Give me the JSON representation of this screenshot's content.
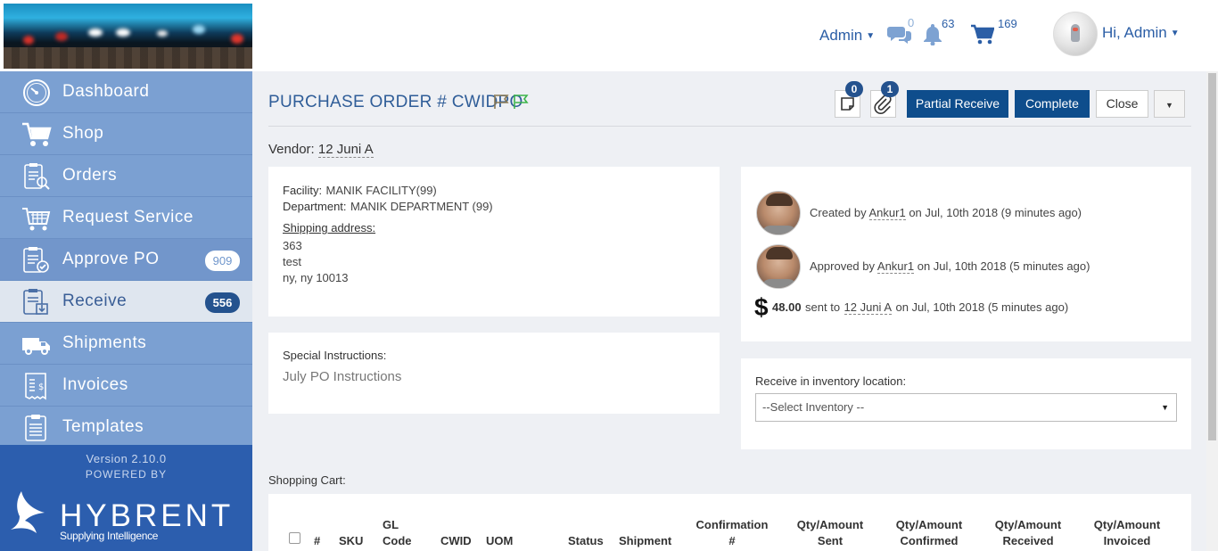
{
  "header": {
    "admin_label": "Admin",
    "messages_count": "0",
    "notifications_count": "63",
    "cart_count": "169",
    "greeting": "Hi, Admin"
  },
  "sidebar": {
    "items": [
      {
        "label": "Dashboard",
        "icon": "dashboard-icon"
      },
      {
        "label": "Shop",
        "icon": "cart-icon"
      },
      {
        "label": "Orders",
        "icon": "orders-icon"
      },
      {
        "label": "Request Service",
        "icon": "request-service-icon"
      },
      {
        "label": "Approve PO",
        "icon": "approve-icon",
        "badge": "909"
      },
      {
        "label": "Receive",
        "icon": "receive-icon",
        "badge": "556",
        "active": true
      },
      {
        "label": "Shipments",
        "icon": "truck-icon"
      },
      {
        "label": "Invoices",
        "icon": "invoice-icon"
      },
      {
        "label": "Templates",
        "icon": "template-icon"
      }
    ],
    "version": "Version 2.10.0",
    "powered_by": "POWERED BY",
    "brand": "HYBRENT",
    "tagline": "Supplying Intelligence"
  },
  "page": {
    "title": "PURCHASE ORDER # CWIDPO",
    "notes_count": "0",
    "attachments_count": "1",
    "buttons": {
      "partial_receive": "Partial Receive",
      "complete": "Complete",
      "close": "Close"
    },
    "vendor_label": "Vendor:",
    "vendor_name": "12 Juni A"
  },
  "facility": {
    "facility_label": "Facility:",
    "facility_value": "MANIK FACILITY(99)",
    "department_label": "Department:",
    "department_value": "MANIK DEPARTMENT (99)",
    "shipping_label": "Shipping address:",
    "address_line1": "363",
    "address_line2": "test",
    "address_line3": "ny, ny 10013"
  },
  "instructions": {
    "label": "Special Instructions:",
    "text": "July PO Instructions"
  },
  "activity": {
    "created_prefix": "Created by",
    "created_user": "Ankur1",
    "created_suffix": "on Jul, 10th 2018 (9 minutes ago)",
    "approved_prefix": "Approved by",
    "approved_user": "Ankur1",
    "approved_suffix": "on Jul, 10th 2018 (5 minutes ago)",
    "currency": "$",
    "amount": "48.00",
    "sent_to": "sent to",
    "sent_vendor": "12 Juni A",
    "sent_suffix": "on Jul, 10th 2018 (5 minutes ago)"
  },
  "inventory": {
    "label": "Receive in inventory location:",
    "select_value": "--Select Inventory --"
  },
  "cart": {
    "label": "Shopping Cart:",
    "columns": {
      "num": "#",
      "sku": "SKU",
      "gl1": "GL",
      "gl2": "Code",
      "cwid": "CWID",
      "uom": "UOM",
      "status": "Status",
      "shipment": "Shipment",
      "conf1": "Confirmation",
      "conf2": "#",
      "sent1": "Qty/Amount",
      "sent2": "Sent",
      "confirmed1": "Qty/Amount",
      "confirmed2": "Confirmed",
      "received1": "Qty/Amount",
      "received2": "Received",
      "invoiced1": "Qty/Amount",
      "invoiced2": "Invoiced"
    }
  },
  "colors": {
    "accent": "#2b5ea6",
    "primary_button": "#0e4d8c",
    "sidebar": "#7ba0d2",
    "sidebar_footer": "#2c5eae"
  }
}
